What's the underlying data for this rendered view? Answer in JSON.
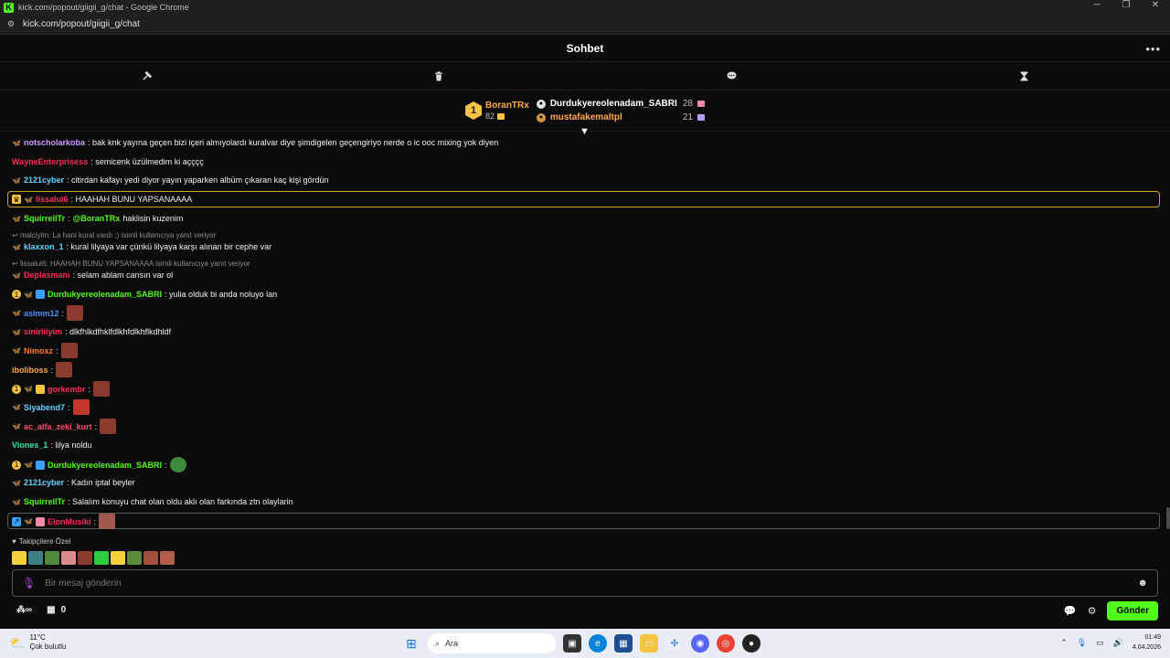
{
  "window": {
    "tab_title": "kick.com/popout/giigii_g/chat - Google Chrome",
    "url": "kick.com/popout/giigii_g/chat"
  },
  "header": {
    "title": "Sohbet"
  },
  "leaderboard": {
    "first": {
      "rank": "1",
      "name": "BoranTRx",
      "score": "82"
    },
    "others": [
      {
        "name": "Durdukyereolenadam_SABRI",
        "score": "28",
        "color": "#ffffff"
      },
      {
        "name": "mustafakemaltpl",
        "score": "21",
        "color": "#ffa83f"
      }
    ]
  },
  "messages": [
    {
      "user": "notscholarkoba",
      "color": "#c79cff",
      "text": ": bak knk yayına geçen bizi içeri almıyolardı kuralvar diye şimdigelen geçengiriyo nerde o ic ooc mixing yok diyen"
    },
    {
      "user": "WayneEnterprisess",
      "color": "#ff2d55",
      "text": ": semicenk üzülmedim ki açççç"
    },
    {
      "user": "2121cyber",
      "color": "#63d1ff",
      "text": ": citirdan kafayı yedi diyor yayın yaparken albüm çıkaran kaç kişi gördün"
    },
    {
      "user": "lissalui6",
      "color": "#ff2d55",
      "text": ": HAAHAH BUNU YAPSANAAAA"
    },
    {
      "user": "SquirrellTr",
      "color": "#53fc18",
      "text": ":",
      "mention": "@BoranTRx",
      "rest": "haklisin kuzenim"
    },
    {
      "reply": "malciyim: La hani kural vardı ;) isimli kullanıcıya yanıt veriyor",
      "user": "klaxxon_1",
      "color": "#63d1ff",
      "text": ": kural lilyaya var çünkü lilyaya karşı alınan bir cephe var"
    },
    {
      "reply": "lissalui6: HAAHAH BUNU YAPSANAAAA isimli kullanıcıya yanıt veriyor",
      "user": "Deplasmanı",
      "color": "#ff2d55",
      "text": ": selam ablam cansın var ol"
    },
    {
      "user": "Durdukyereolenadam_SABRI",
      "color": "#53fc18",
      "text": ": yulia olduk bi anda noluyo lan"
    },
    {
      "user": "asimm12",
      "color": "#4f8cff",
      "text": ":"
    },
    {
      "user": "sinirliiyim",
      "color": "#ff2d55",
      "text": ": dlkfhlkdfhklfdlkhfdlkhflkdhldf"
    },
    {
      "user": "Nimoxz",
      "color": "#ff7a1a",
      "text": ":"
    },
    {
      "user": "iboliboss",
      "color": "#ffa83f",
      "text": ":"
    },
    {
      "user": "gorkembr",
      "color": "#ff2d55",
      "text": ":"
    },
    {
      "user": "Siyabend7",
      "color": "#63d1ff",
      "text": ":"
    },
    {
      "user": "ac_alfa_zeki_kurt",
      "color": "#ff4d6d",
      "text": ":"
    },
    {
      "user": "Viones_1",
      "color": "#2ee6a8",
      "text": ": lilya noldu"
    },
    {
      "user": "Durdukyereolenadam_SABRI",
      "color": "#53fc18",
      "text": ":"
    },
    {
      "user": "2121cyber",
      "color": "#63d1ff",
      "text": ": Kadın iptal beyler"
    },
    {
      "user": "SquirrellTr",
      "color": "#53fc18",
      "text": ": Salalım konuyu chat olan oldu aklı olan farkında ztn olaylarin"
    },
    {
      "user": "ElonMusiki",
      "color": "#ff2d55",
      "text": ":"
    }
  ],
  "followers_label": "Takipçilere Özel",
  "input": {
    "placeholder": "Bir mesaj gönderin"
  },
  "bottom": {
    "points": "0",
    "send_label": "Gönder"
  },
  "taskbar": {
    "weather_temp": "11°C",
    "weather_desc": "Çok bulutlu",
    "search_label": "Ara",
    "time": "01:49",
    "date": "4.04.2026"
  },
  "colors": {
    "accent": "#53fc18",
    "highlight_border": "#c9a227",
    "background": "#0b0b0c"
  }
}
